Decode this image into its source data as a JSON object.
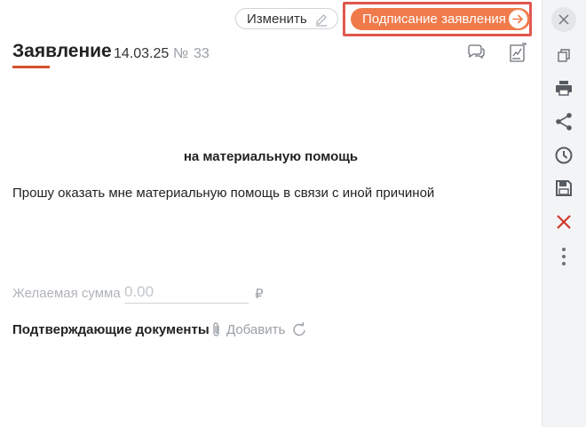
{
  "toolbar": {
    "edit_label": "Изменить",
    "sign_label": "Подписание заявления"
  },
  "header": {
    "title": "Заявление",
    "date": "14.03.25",
    "number_sign": "№",
    "number": "33"
  },
  "document": {
    "subject": "на материальную помощь",
    "body": "Прошу оказать мне материальную помощь в связи с иной причиной",
    "amount_label": "Желаемая сумма",
    "amount_placeholder": "0.00",
    "currency": "₽",
    "docs_label": "Подтверждающие документы",
    "add_label": "Добавить"
  },
  "colors": {
    "accent": "#f07a4a",
    "highlight": "#e0574f",
    "underline": "#d5502b",
    "delete": "#d0382b"
  },
  "icons": {
    "edit": "pencil-icon",
    "sign_arrow": "arrow-right-icon",
    "comments": "chat-bubbles-icon",
    "sign_doc": "document-sign-icon",
    "close": "close-icon",
    "copy": "copy-icon",
    "print": "printer-icon",
    "share": "share-icon",
    "history": "clock-icon",
    "save": "floppy-disk-icon",
    "delete": "delete-x-icon",
    "more": "more-vertical-icon",
    "attach": "paperclip-icon",
    "refresh": "refresh-icon"
  }
}
